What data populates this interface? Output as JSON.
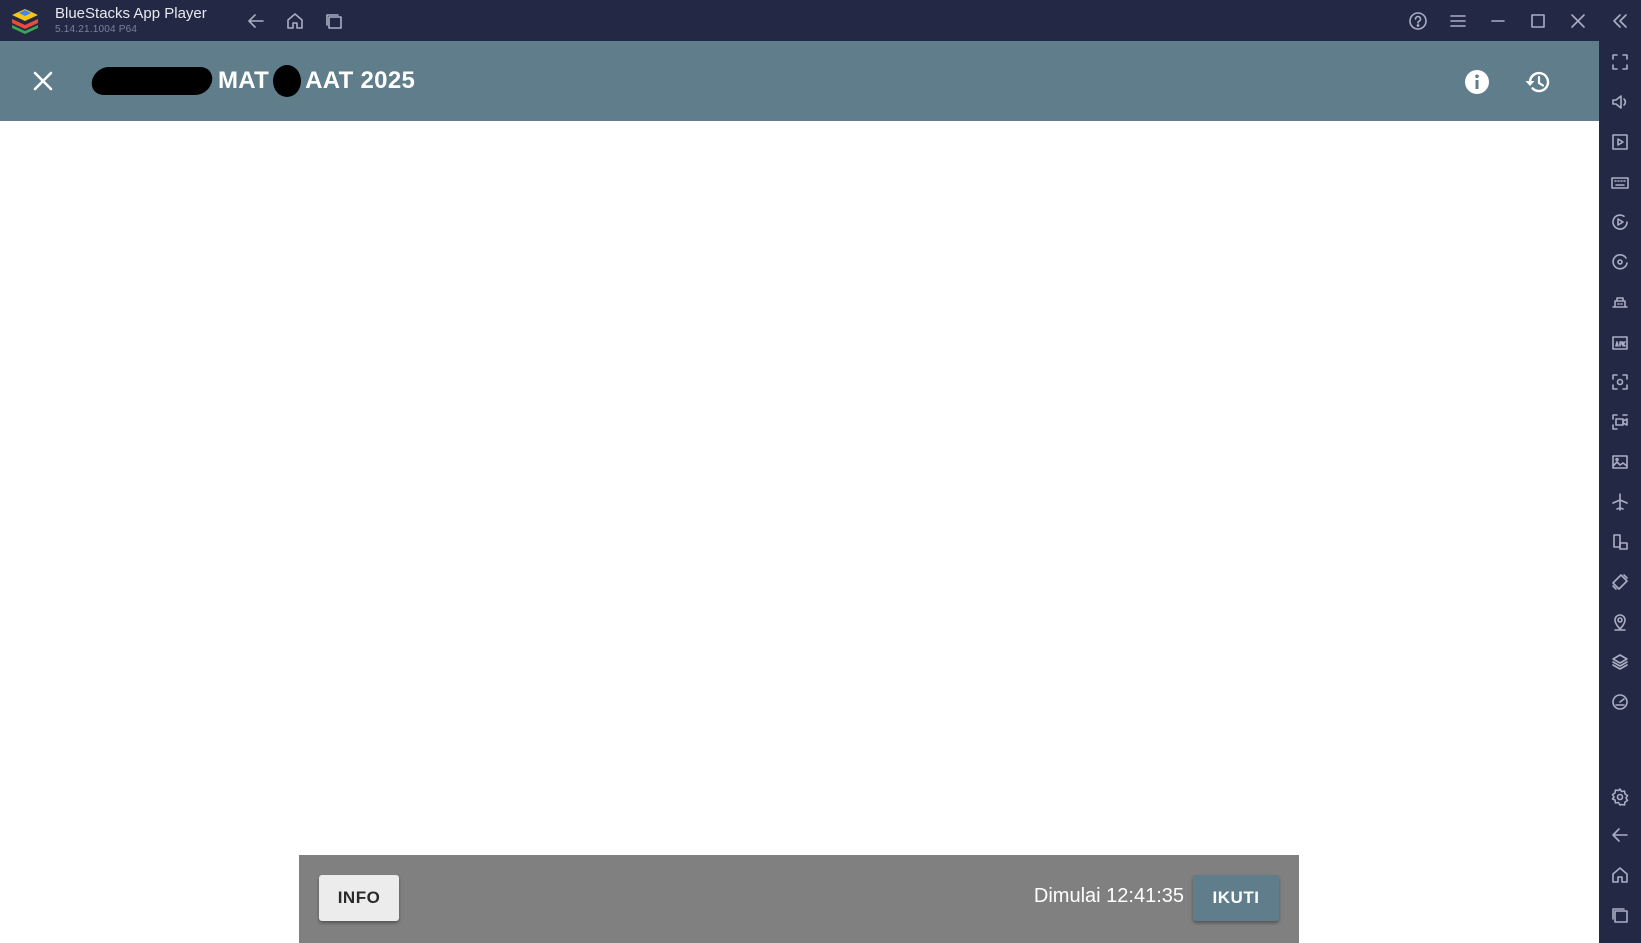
{
  "titlebar": {
    "app_name": "BlueStacks App Player",
    "version": "5.14.21.1004  P64",
    "nav_icons": [
      "back-arrow-icon",
      "home-icon",
      "recent-apps-icon"
    ],
    "window_icons": [
      "help-icon",
      "menu-icon",
      "minimize-icon",
      "maximize-icon",
      "close-icon",
      "collapse-sidebar-icon"
    ]
  },
  "app_header": {
    "title_part1": "MAT",
    "title_part2": "AAT 2025",
    "background_color": "#607d8b",
    "icons": [
      "close-icon",
      "info-icon",
      "history-icon"
    ]
  },
  "bottom_bar": {
    "info_label": "INFO",
    "timer_text": "Dimulai 12:41:35",
    "follow_label": "IKUTI"
  },
  "sidebar": {
    "icons": [
      "fullscreen-icon",
      "volume-icon",
      "media-icon",
      "keyboard-icon",
      "macro-record-icon",
      "sync-icon",
      "game-controls-icon",
      "install-apk-icon",
      "screenshot-icon",
      "screen-record-icon",
      "media-folder-icon",
      "airplane-mode-icon",
      "rotate-icon",
      "shake-icon",
      "location-icon",
      "multi-instance-icon",
      "eco-mode-icon",
      "settings-icon",
      "back-icon",
      "home-icon",
      "recent-apps-icon"
    ]
  },
  "colors": {
    "titlebar_bg": "#232944",
    "header_bg": "#607d8b",
    "bottom_bar_bg": "#808080",
    "follow_button_bg": "#607d8b"
  }
}
